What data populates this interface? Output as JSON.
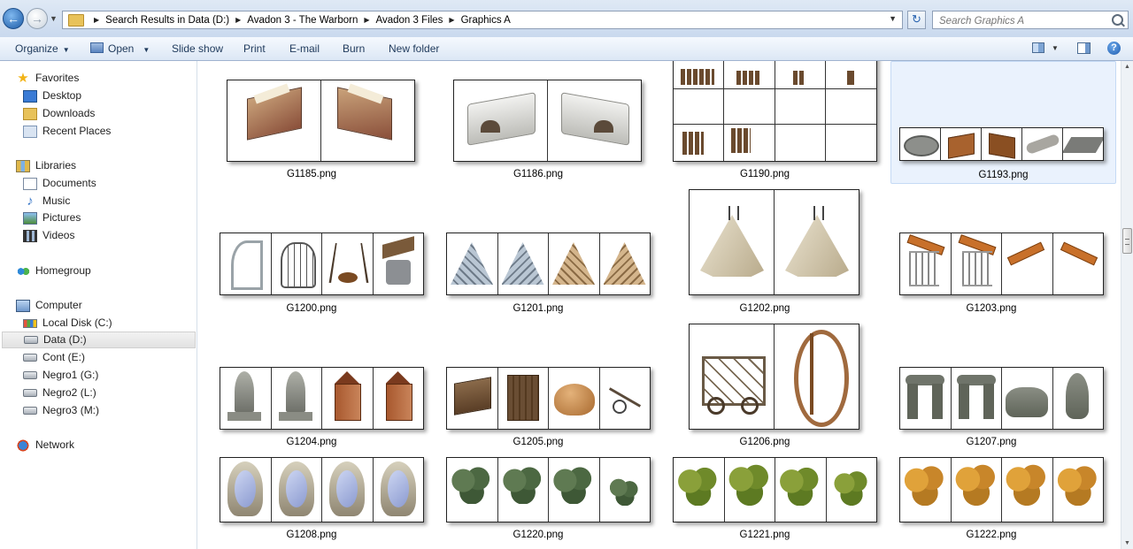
{
  "nav": {
    "back_icon": "back-arrow-icon",
    "forward_icon": "forward-arrow-icon"
  },
  "address": {
    "breadcrumbs": [
      "Search Results in Data (D:)",
      "Avadon 3 - The Warborn",
      "Avadon 3 Files",
      "Graphics A"
    ],
    "refresh_icon": "refresh-icon"
  },
  "search": {
    "placeholder": "Search Graphics A"
  },
  "toolbar": {
    "organize": "Organize",
    "open": "Open",
    "slideshow": "Slide show",
    "print": "Print",
    "email": "E-mail",
    "burn": "Burn",
    "new_folder": "New folder",
    "help": "?"
  },
  "sidebar": {
    "favorites": "Favorites",
    "desktop": "Desktop",
    "downloads": "Downloads",
    "recent_places": "Recent Places",
    "libraries": "Libraries",
    "documents": "Documents",
    "music": "Music",
    "pictures": "Pictures",
    "videos": "Videos",
    "homegroup": "Homegroup",
    "computer": "Computer",
    "local_disk_c": "Local Disk (C:)",
    "data_d": "Data (D:)",
    "cont_e": "Cont (E:)",
    "negro1_g": "Negro1 (G:)",
    "negro2_l": "Negro2 (L:)",
    "negro3_m": "Negro3 (M:)",
    "network": "Network"
  },
  "files": [
    {
      "name": "G1185.png",
      "preview": "sprite-sheet: ornate wooden table with scroll, 2 frames"
    },
    {
      "name": "G1186.png",
      "preview": "sprite-sheet: stone oven, 2 frames"
    },
    {
      "name": "G1190.png",
      "preview": "sprite-sheet: wooden palisade stakes, grid"
    },
    {
      "name": "G1193.png",
      "preview": "sprite-sheet: stone trough, crates, log, slab, 5 frames"
    },
    {
      "name": "G1200.png",
      "preview": "sprite-sheet: spiral stair, cage, tripod cauldron, well, 4 frames"
    },
    {
      "name": "G1201.png",
      "preview": "sprite-sheet: stone and wooden ramps, 4 frames"
    },
    {
      "name": "G1202.png",
      "preview": "sprite-sheet: hide tent, 2 frames"
    },
    {
      "name": "G1203.png",
      "preview": "sprite-sheet: wooden beams and railings, 4 frames"
    },
    {
      "name": "G1204.png",
      "preview": "sprite-sheet: stone statues and brick shrines, 4 frames"
    },
    {
      "name": "G1205.png",
      "preview": "sprite-sheet: wooden hut, outhouse, haystack, wheelbarrow, 4 frames"
    },
    {
      "name": "G1206.png",
      "preview": "sprite-sheet: catapult and spiral staircase, 2 frames"
    },
    {
      "name": "G1207.png",
      "preview": "sprite-sheet: standing stones, 4 frames"
    },
    {
      "name": "G1208.png",
      "preview": "sprite-sheet: stone portal mirror, 4 frames"
    },
    {
      "name": "G1220.png",
      "preview": "sprite-sheet: dark green shrubs, 4 frames"
    },
    {
      "name": "G1221.png",
      "preview": "sprite-sheet: green trees, 4 frames"
    },
    {
      "name": "G1222.png",
      "preview": "sprite-sheet: autumn trees, 4 frames"
    }
  ],
  "colors": {
    "wood": "#8a5a3a",
    "stone": "#b9b6ad",
    "selection": "#eaf2fd",
    "accent": "#1c5aa6"
  }
}
